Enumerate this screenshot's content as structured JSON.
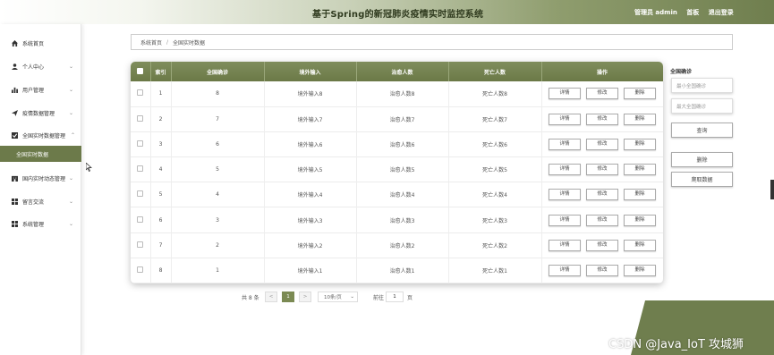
{
  "header": {
    "title": "基于Spring的新冠肺炎疫情实时监控系统",
    "admin": "管理员 admin",
    "home": "首板",
    "logout": "退出登录"
  },
  "sidebar": {
    "items": [
      {
        "label": "系统首页",
        "icon": "home-icon",
        "arrow": ""
      },
      {
        "label": "个人中心",
        "icon": "user-icon",
        "arrow": "⌄"
      },
      {
        "label": "用户管理",
        "icon": "chart-icon",
        "arrow": "⌄"
      },
      {
        "label": "疫情数据管理",
        "icon": "send-icon",
        "arrow": "⌄"
      },
      {
        "label": "全国实时数据管理",
        "icon": "check-icon",
        "arrow": "⌃"
      },
      {
        "label": "国内实时动态管理",
        "icon": "building-icon",
        "arrow": "⌄"
      },
      {
        "label": "留言交流",
        "icon": "grid-icon",
        "arrow": "⌄"
      },
      {
        "label": "系统管理",
        "icon": "grid-icon",
        "arrow": "⌄"
      }
    ],
    "active_sub": "全国实时数据"
  },
  "breadcrumb": {
    "home": "系统首页",
    "sep": "/",
    "current": "全国实时数据"
  },
  "table": {
    "headers": [
      "",
      "索引",
      "全国确诊",
      "境外输入",
      "治愈人数",
      "死亡人数",
      "操作"
    ],
    "rows": [
      {
        "index": "1",
        "confirmed": "8",
        "imported": "境外输入8",
        "cured": "治愈人数8",
        "dead": "死亡人数8"
      },
      {
        "index": "2",
        "confirmed": "7",
        "imported": "境外输入7",
        "cured": "治愈人数7",
        "dead": "死亡人数7"
      },
      {
        "index": "3",
        "confirmed": "6",
        "imported": "境外输入6",
        "cured": "治愈人数6",
        "dead": "死亡人数6"
      },
      {
        "index": "4",
        "confirmed": "5",
        "imported": "境外输入5",
        "cured": "治愈人数5",
        "dead": "死亡人数5"
      },
      {
        "index": "5",
        "confirmed": "4",
        "imported": "境外输入4",
        "cured": "治愈人数4",
        "dead": "死亡人数4"
      },
      {
        "index": "6",
        "confirmed": "3",
        "imported": "境外输入3",
        "cured": "治愈人数3",
        "dead": "死亡人数3"
      },
      {
        "index": "7",
        "confirmed": "2",
        "imported": "境外输入2",
        "cured": "治愈人数2",
        "dead": "死亡人数2"
      },
      {
        "index": "8",
        "confirmed": "1",
        "imported": "境外输入1",
        "cured": "治愈人数1",
        "dead": "死亡人数1"
      }
    ],
    "actions": {
      "detail": "详情",
      "edit": "修改",
      "delete": "删除"
    }
  },
  "right_panel": {
    "label": "全国确诊",
    "min_placeholder": "最小全国确诊",
    "max_placeholder": "最大全国确诊",
    "search": "查询",
    "delete": "删除",
    "fetch": "爬取数据"
  },
  "pagination": {
    "total": "共 8 条",
    "prev": "<",
    "page": "1",
    "next": ">",
    "size": "10条/页",
    "size_arrow": "⌄",
    "goto": "前往",
    "goto_value": "1",
    "unit": "页"
  },
  "watermark": "CSDN @Java_IoT 攻城狮",
  "colors": {
    "accent": "#6f7e4e",
    "header_text": "#2f3a1e"
  }
}
